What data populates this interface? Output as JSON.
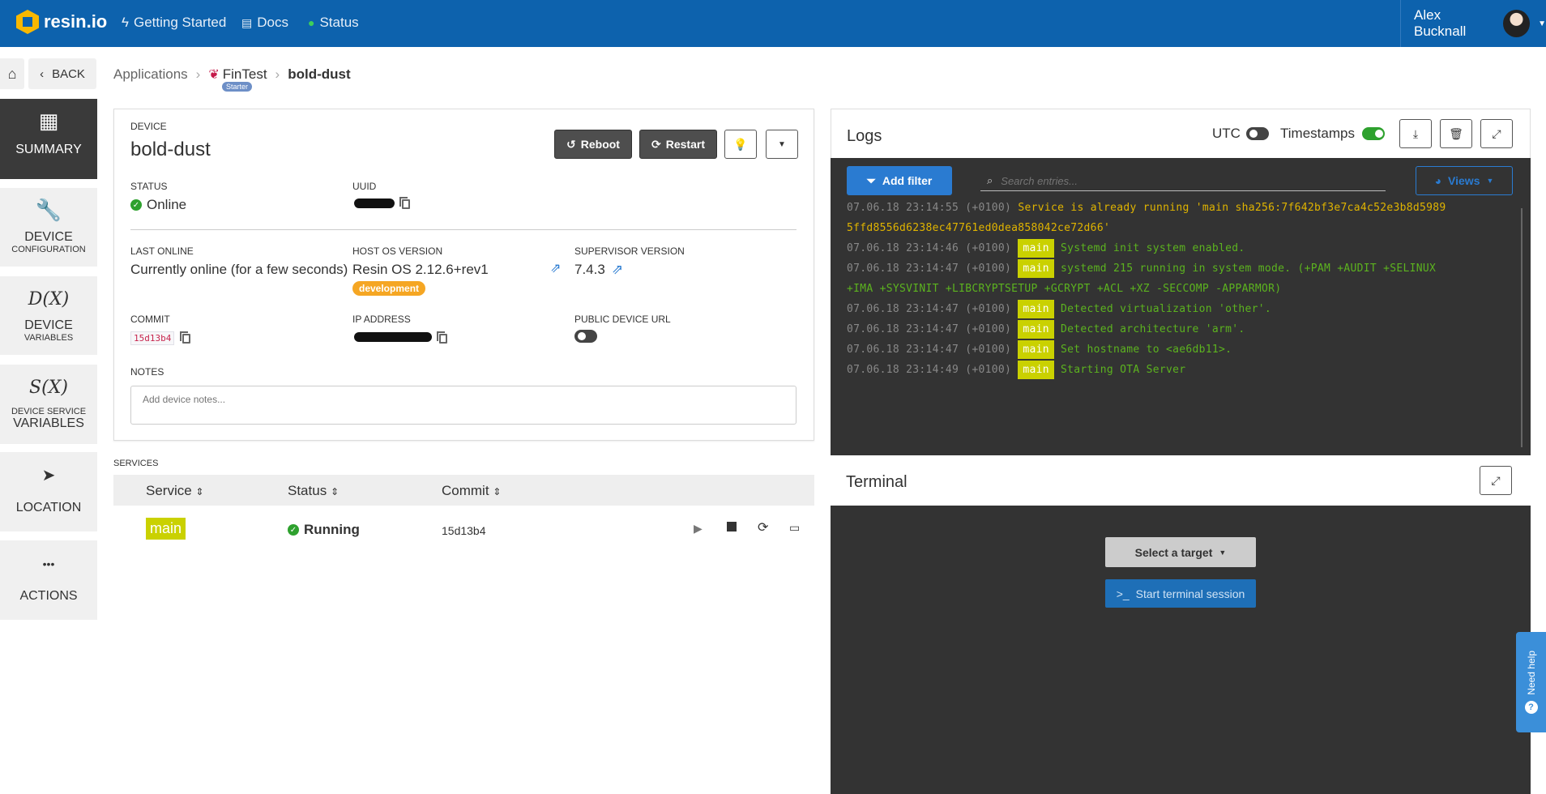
{
  "topbar": {
    "brand": "resin.io",
    "nav": [
      {
        "label": "Getting Started",
        "icon": "bolt-icon"
      },
      {
        "label": "Docs",
        "icon": "document-icon"
      },
      {
        "label": "Status",
        "icon": "status-dot-icon"
      }
    ],
    "user": "Alex Bucknall",
    "brand_color": "#0d62ad",
    "accent_color": "#f9b800"
  },
  "sidebar": [
    {
      "label": "SUMMARY",
      "sub": "",
      "icon": "grid-icon",
      "active": true
    },
    {
      "label": "DEVICE",
      "sub": "CONFIGURATION",
      "icon": "wrench-icon"
    },
    {
      "label": "DEVICE",
      "sub": "VARIABLES",
      "icon": "dx-icon",
      "icon_text": "D(X)"
    },
    {
      "label": "VARIABLES",
      "sub": "DEVICE SERVICE",
      "icon": "sx-icon",
      "icon_text": "S(X)"
    },
    {
      "label": "LOCATION",
      "sub": "",
      "icon": "location-arrow-icon"
    },
    {
      "label": "ACTIONS",
      "sub": "",
      "icon": "dots-icon",
      "icon_text": "•••"
    }
  ],
  "breadcrumb": {
    "back": "BACK",
    "applications": "Applications",
    "app": "FinTest",
    "app_badge": "Starter",
    "device": "bold-dust"
  },
  "device": {
    "section_label": "DEVICE",
    "name": "bold-dust",
    "reboot": "Reboot",
    "restart": "Restart",
    "status_label": "STATUS",
    "status": "Online",
    "uuid_label": "UUID",
    "last_online_label": "LAST ONLINE",
    "last_online": "Currently online (for a few seconds)",
    "host_os_label": "HOST OS VERSION",
    "host_os": "Resin OS 2.12.6+rev1",
    "host_os_badge": "development",
    "supervisor_label": "SUPERVISOR VERSION",
    "supervisor": "7.4.3",
    "commit_label": "COMMIT",
    "commit": "15d13b4",
    "ip_label": "IP ADDRESS",
    "public_url_label": "PUBLIC DEVICE URL",
    "notes_label": "NOTES",
    "notes_placeholder": "Add device notes..."
  },
  "services": {
    "label": "SERVICES",
    "columns": [
      "Service",
      "Status",
      "Commit"
    ],
    "rows": [
      {
        "service": "main",
        "status": "Running",
        "commit": "15d13b4"
      }
    ]
  },
  "logs": {
    "title": "Logs",
    "utc": "UTC",
    "timestamps": "Timestamps",
    "add_filter": "Add filter",
    "search_placeholder": "Search entries...",
    "views": "Views",
    "lines": [
      {
        "ts": "07.06.18 23:14:55 (+0100)",
        "svc": "",
        "msg": "Service is already running 'main sha256:7f642bf3e7ca4c52e3b8d5989",
        "cont": "5ffd8556d6238ec47761ed0dea858042ce72d66'",
        "color": "#e0b400"
      },
      {
        "ts": "07.06.18 23:14:46 (+0100)",
        "svc": "main",
        "msg": "Systemd init system enabled.",
        "color": "#5cb31f"
      },
      {
        "ts": "07.06.18 23:14:47 (+0100)",
        "svc": "main",
        "msg": "systemd 215 running in system mode. (+PAM +AUDIT +SELINUX",
        "cont": "+IMA +SYSVINIT +LIBCRYPTSETUP +GCRYPT +ACL +XZ -SECCOMP -APPARMOR)",
        "color": "#5cb31f"
      },
      {
        "ts": "07.06.18 23:14:47 (+0100)",
        "svc": "main",
        "msg": "Detected virtualization 'other'.",
        "color": "#5cb31f"
      },
      {
        "ts": "07.06.18 23:14:47 (+0100)",
        "svc": "main",
        "msg": "Detected architecture 'arm'.",
        "color": "#5cb31f"
      },
      {
        "ts": "07.06.18 23:14:47 (+0100)",
        "svc": "main",
        "msg": "Set hostname to <ae6db11>.",
        "color": "#5cb31f"
      },
      {
        "ts": "07.06.18 23:14:49 (+0100)",
        "svc": "main",
        "msg": "Starting OTA Server",
        "color": "#5cb31f"
      }
    ]
  },
  "terminal": {
    "title": "Terminal",
    "select_target": "Select a target",
    "start": "Start terminal session"
  },
  "help": "Need help"
}
